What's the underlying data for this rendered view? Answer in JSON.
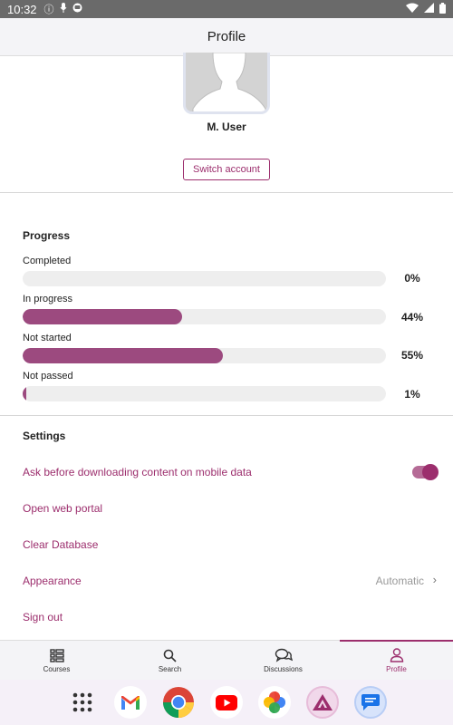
{
  "status_bar": {
    "time": "10:32"
  },
  "app_bar": {
    "title": "Profile"
  },
  "profile": {
    "user_name": "M. User",
    "switch_account_label": "Switch account"
  },
  "progress": {
    "title": "Progress",
    "items": [
      {
        "label": "Completed",
        "percent_label": "0%",
        "value": 0
      },
      {
        "label": "In progress",
        "percent_label": "44%",
        "value": 44
      },
      {
        "label": "Not started",
        "percent_label": "55%",
        "value": 55
      },
      {
        "label": "Not passed",
        "percent_label": "1%",
        "value": 1
      }
    ]
  },
  "settings": {
    "title": "Settings",
    "ask_download": "Ask before downloading content on mobile data",
    "ask_download_enabled": true,
    "open_portal": "Open web portal",
    "clear_db": "Clear Database",
    "appearance": "Appearance",
    "appearance_value": "Automatic",
    "sign_out": "Sign out"
  },
  "bottom_nav": {
    "items": [
      {
        "label": "Courses",
        "icon": "courses-icon"
      },
      {
        "label": "Search",
        "icon": "search-icon"
      },
      {
        "label": "Discussions",
        "icon": "discussions-icon"
      },
      {
        "label": "Profile",
        "icon": "profile-icon",
        "active": true
      }
    ]
  },
  "dock": {
    "apps": [
      "app-drawer-icon",
      "gmail-icon",
      "chrome-icon",
      "youtube-icon",
      "photos-icon",
      "learning-app-icon",
      "messages-icon"
    ]
  },
  "colors": {
    "accent": "#9c2e6d",
    "progress_fill": "#9c4a7f",
    "track": "#eeeeee"
  }
}
